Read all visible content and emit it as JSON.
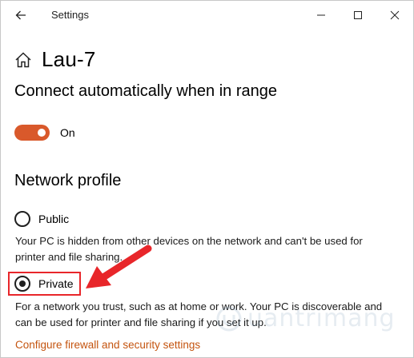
{
  "window": {
    "title": "Settings"
  },
  "header": {
    "network_name": "Lau-7"
  },
  "connect": {
    "heading": "Connect automatically when in range",
    "toggle_state": "On"
  },
  "profile": {
    "heading": "Network profile",
    "options": [
      {
        "label": "Public",
        "selected": false,
        "description": "Your PC is hidden from other devices on the network and can't be used for printer and file sharing."
      },
      {
        "label": "Private",
        "selected": true,
        "description": "For a network you trust, such as at home or work. Your PC is discoverable and can be used for printer and file sharing if you set it up."
      }
    ]
  },
  "links": {
    "firewall": "Configure firewall and security settings"
  },
  "watermark": {
    "text": "uantrimang"
  },
  "colors": {
    "accent": "#d9592b",
    "link": "#c4540f",
    "highlight": "#e8262a"
  },
  "icons": [
    "back-arrow-icon",
    "minimize-icon",
    "maximize-icon",
    "close-icon",
    "home-icon",
    "red-arrow-icon"
  ]
}
